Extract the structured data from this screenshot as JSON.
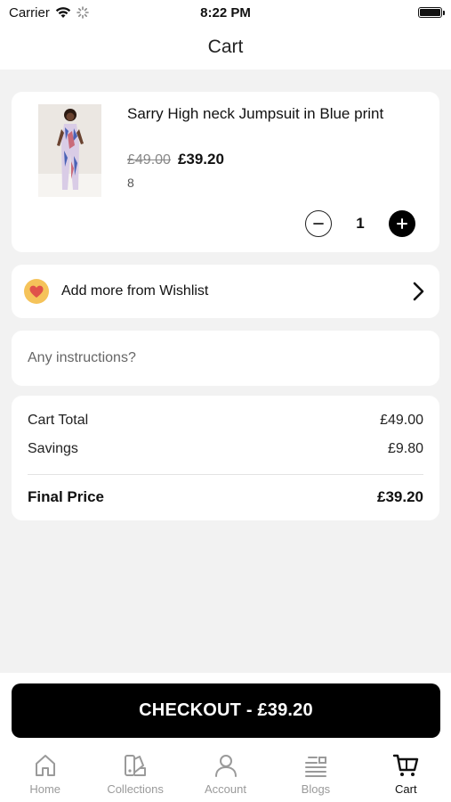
{
  "status_bar": {
    "carrier": "Carrier",
    "time": "8:22 PM"
  },
  "header": {
    "title": "Cart"
  },
  "cart_item": {
    "name": "Sarry High neck Jumpsuit in Blue print",
    "price_original": "£49.00",
    "price_sale": "£39.20",
    "size": "8",
    "quantity": "1"
  },
  "wishlist": {
    "label": "Add more from Wishlist"
  },
  "instructions": {
    "placeholder": "Any instructions?"
  },
  "summary": {
    "cart_total_label": "Cart Total",
    "cart_total_value": "£49.00",
    "savings_label": "Savings",
    "savings_value": "£9.80",
    "final_label": "Final Price",
    "final_value": "£39.20"
  },
  "checkout": {
    "label": "CHECKOUT - £39.20"
  },
  "tabs": [
    {
      "label": "Home",
      "icon": "home-icon"
    },
    {
      "label": "Collections",
      "icon": "collections-icon"
    },
    {
      "label": "Account",
      "icon": "account-icon"
    },
    {
      "label": "Blogs",
      "icon": "blogs-icon"
    },
    {
      "label": "Cart",
      "icon": "cart-icon",
      "active": true
    }
  ],
  "colors": {
    "accent": "#000000",
    "wishlist_badge": "#f5c35a",
    "heart": "#e0524a",
    "inactive_tab": "#9a9a9a"
  }
}
